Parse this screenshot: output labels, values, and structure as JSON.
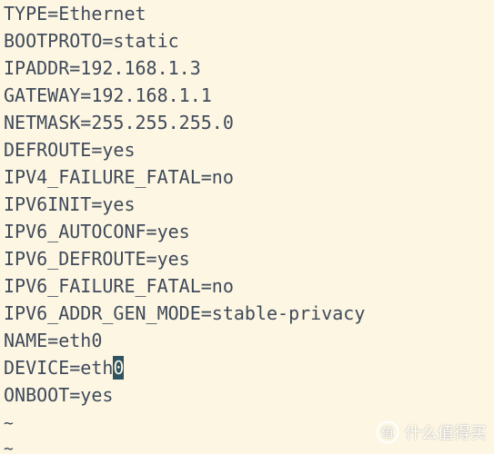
{
  "file_lines": [
    "TYPE=Ethernet",
    "BOOTPROTO=static",
    "IPADDR=192.168.1.3",
    "GATEWAY=192.168.1.1",
    "NETMASK=255.255.255.0",
    "DEFROUTE=yes",
    "IPV4_FAILURE_FATAL=no",
    "IPV6INIT=yes",
    "IPV6_AUTOCONF=yes",
    "IPV6_DEFROUTE=yes",
    "IPV6_FAILURE_FATAL=no",
    "IPV6_ADDR_GEN_MODE=stable-privacy",
    "NAME=eth0",
    "DEVICE=eth",
    "ONBOOT=yes"
  ],
  "cursor_char": "0",
  "empty_line_marker": "~",
  "watermark": {
    "logo_char": "值",
    "text": "什么值得买"
  },
  "colors": {
    "background": "#fdf6e3",
    "text": "#3f4a5a",
    "cursor_bg": "#2f5360",
    "cursor_fg": "#fdf6e3"
  }
}
